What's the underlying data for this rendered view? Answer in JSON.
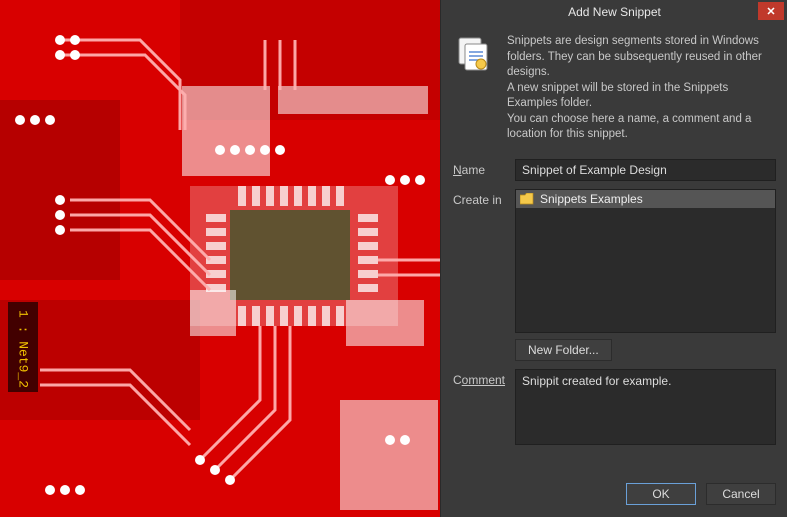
{
  "dialog": {
    "title": "Add New Snippet",
    "intro_p1": "Snippets are design segments stored in Windows folders. They can be subsequently reused in other designs.",
    "intro_p2": "A new snippet will be stored in the Snippets Examples folder.",
    "intro_p3": "You can choose here a name, a comment and a location for this snippet.",
    "name_label_pre": "N",
    "name_label_post": "ame",
    "createin_label": "Create in",
    "comment_label_pre": "C",
    "comment_label_post": "omment",
    "newfolder_label_pre": "Ne",
    "newfolder_label_under": "w",
    "newfolder_label_post": " Folder...",
    "ok_label": "OK",
    "cancel_label": "Cancel",
    "close_symbol": "✕"
  },
  "fields": {
    "name_value": "Snippet of Example Design",
    "comment_value": "Snippit created for example."
  },
  "tree": {
    "selected_label": "Snippets Examples"
  },
  "pcb": {
    "net_label": "1 : Net9_2"
  }
}
